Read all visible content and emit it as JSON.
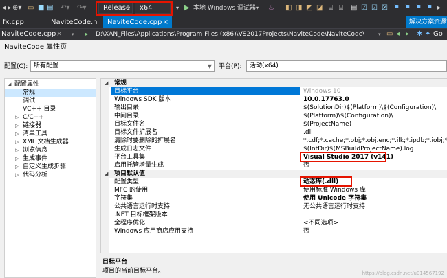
{
  "toolbar": {
    "configuration": "Release",
    "platform": "x64",
    "debugger_label": "本地 Windows 调试器",
    "go_label": "Go"
  },
  "tabs": {
    "items": [
      {
        "label": "fx.cpp"
      },
      {
        "label": "NaviteCode.h"
      },
      {
        "label": "NaviteCode.cpp",
        "close": "×",
        "active": true
      }
    ],
    "solution_explorer": "解决方案资源管理"
  },
  "pathbar": {
    "file": "NaviteCode.cpp",
    "close": "×",
    "path": "D:\\XAN_Files\\Applications\\Program Files (x86)\\VS2017Projects\\NaviteCode\\NaviteCode\\"
  },
  "dialog": {
    "title": "NaviteCode 属性页",
    "config_label": "配置(C):",
    "config_value": "所有配置",
    "platform_label": "平台(P):",
    "platform_value": "活动(x64)"
  },
  "tree": {
    "items": [
      {
        "label": "配置属性",
        "indent": 1,
        "twisty": "◢"
      },
      {
        "label": "常规",
        "indent": 2,
        "selected": true
      },
      {
        "label": "调试",
        "indent": 2
      },
      {
        "label": "VC++ 目录",
        "indent": 2
      },
      {
        "label": "C/C++",
        "indent": 2,
        "twisty": "▷"
      },
      {
        "label": "链接器",
        "indent": 2,
        "twisty": "▷"
      },
      {
        "label": "清单工具",
        "indent": 2,
        "twisty": "▷"
      },
      {
        "label": "XML 文档生成器",
        "indent": 2,
        "twisty": "▷"
      },
      {
        "label": "浏览信息",
        "indent": 2,
        "twisty": "▷"
      },
      {
        "label": "生成事件",
        "indent": 2,
        "twisty": "▷"
      },
      {
        "label": "自定义生成步骤",
        "indent": 2,
        "twisty": "▷"
      },
      {
        "label": "代码分析",
        "indent": 2,
        "twisty": "▷"
      }
    ]
  },
  "grid": {
    "sections": [
      {
        "title": "常规",
        "twisty": "◢",
        "rows": [
          {
            "name": "目标平台",
            "value": "Windows 10",
            "style": "gray",
            "selected": true
          },
          {
            "name": "Windows SDK 版本",
            "value": "10.0.17763.0",
            "style": "bold"
          },
          {
            "name": "输出目录",
            "value": "$(SolutionDir)$(Platform)\\$(Configuration)\\"
          },
          {
            "name": "中间目录",
            "value": "$(Platform)\\$(Configuration)\\"
          },
          {
            "name": "目标文件名",
            "value": "$(ProjectName)"
          },
          {
            "name": "目标文件扩展名",
            "value": ".dll"
          },
          {
            "name": "清除时要删除的扩展名",
            "value": "*.cdf;*.cache;*.obj;*.obj.enc;*.ilk;*.ipdb;*.iobj;*.resources;"
          },
          {
            "name": "生成日志文件",
            "value": "$(IntDir)$(MSBuildProjectName).log"
          },
          {
            "name": "平台工具集",
            "value": "Visual Studio 2017 (v141)",
            "style": "bold"
          },
          {
            "name": "启用托管增量生成",
            "value": "否"
          }
        ]
      },
      {
        "title": "项目默认值",
        "twisty": "◢",
        "rows": [
          {
            "name": "配置类型",
            "value": "动态库(.dll)",
            "style": "bold"
          },
          {
            "name": "MFC 的使用",
            "value": "使用标准 Windows 库"
          },
          {
            "name": "字符集",
            "value": "使用 Unicode 字符集",
            "style": "bold"
          },
          {
            "name": "公共语言运行时支持",
            "value": "无公共语言运行时支持"
          },
          {
            "name": ".NET 目标框架版本",
            "value": ""
          },
          {
            "name": "全程序优化",
            "value": "<不同选项>"
          },
          {
            "name": "Windows 应用商店应用支持",
            "value": "否"
          }
        ]
      }
    ]
  },
  "description": {
    "title": "目标平台",
    "text": "项目的当前目标平台。",
    "watermark": "https://blog.csdn.net/u014567192"
  }
}
